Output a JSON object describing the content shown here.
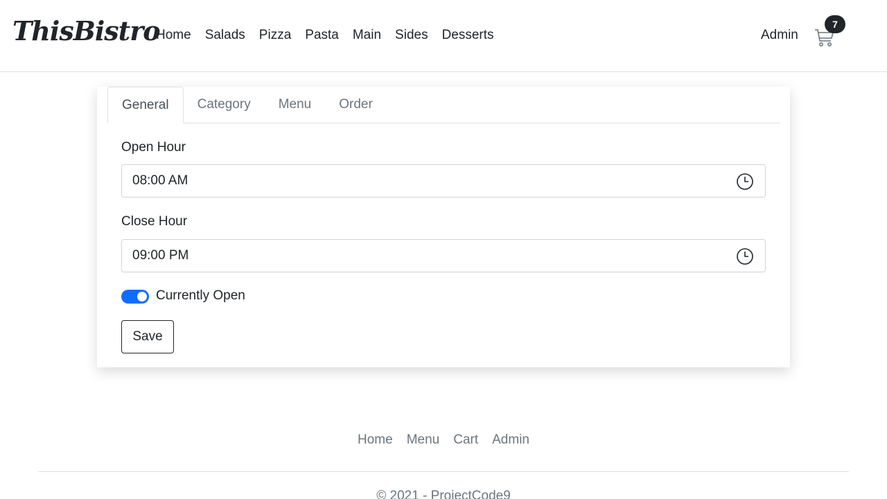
{
  "brand": "ThisBistro",
  "nav": {
    "items": [
      {
        "label": "Home"
      },
      {
        "label": "Salads"
      },
      {
        "label": "Pizza"
      },
      {
        "label": "Pasta"
      },
      {
        "label": "Main"
      },
      {
        "label": "Sides"
      },
      {
        "label": "Desserts"
      }
    ],
    "admin": "Admin",
    "cart_icon": "cart-icon",
    "cart_count": "7"
  },
  "tabs": [
    {
      "label": "General",
      "active": true
    },
    {
      "label": "Category",
      "active": false
    },
    {
      "label": "Menu",
      "active": false
    },
    {
      "label": "Order",
      "active": false
    }
  ],
  "form": {
    "open_hour_label": "Open Hour",
    "open_hour_value": "08:00  AM",
    "close_hour_label": "Close Hour",
    "close_hour_value": "09:00  PM",
    "clock_icon": "clock-icon",
    "currently_open_label": "Currently Open",
    "currently_open": true,
    "save_label": "Save"
  },
  "footer": {
    "links": [
      {
        "label": "Home"
      },
      {
        "label": "Menu"
      },
      {
        "label": "Cart"
      },
      {
        "label": "Admin"
      }
    ],
    "copyright": "© 2021 - ProjectCode9"
  },
  "colors": {
    "accent": "#0d6efd",
    "text": "#212529",
    "muted": "#6c757d",
    "border": "#dee2e6"
  }
}
